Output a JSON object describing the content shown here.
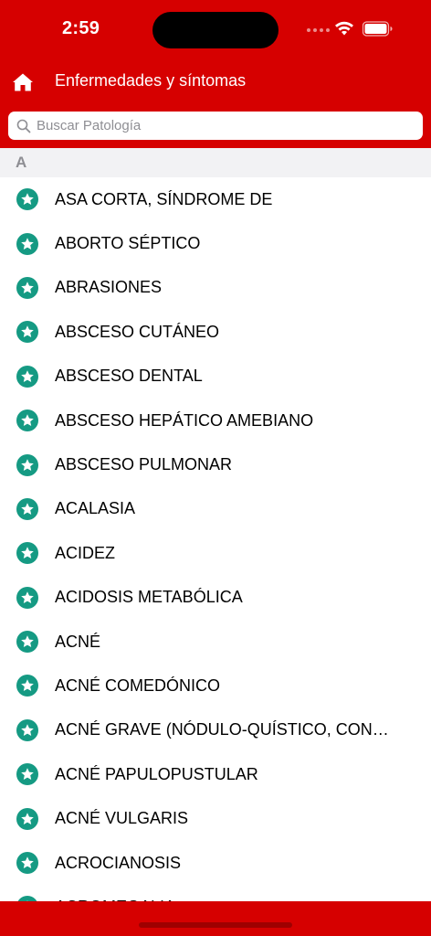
{
  "status": {
    "time": "2:59"
  },
  "nav": {
    "title": "Enfermedades y síntomas",
    "home_icon": "home-icon"
  },
  "search": {
    "placeholder": "Buscar Patología",
    "value": ""
  },
  "section": {
    "letter": "A"
  },
  "items": [
    {
      "label": "ASA CORTA, SÍNDROME DE"
    },
    {
      "label": "ABORTO SÉPTICO"
    },
    {
      "label": "ABRASIONES"
    },
    {
      "label": "ABSCESO CUTÁNEO"
    },
    {
      "label": "ABSCESO DENTAL"
    },
    {
      "label": "ABSCESO HEPÁTICO AMEBIANO"
    },
    {
      "label": "ABSCESO PULMONAR"
    },
    {
      "label": "ACALASIA"
    },
    {
      "label": "ACIDEZ"
    },
    {
      "label": "ACIDOSIS METABÓLICA"
    },
    {
      "label": "ACNÉ"
    },
    {
      "label": "ACNÉ COMEDÓNICO"
    },
    {
      "label": "ACNÉ GRAVE (NÓDULO-QUÍSTICO, CONG..."
    },
    {
      "label": "ACNÉ PAPULOPUSTULAR"
    },
    {
      "label": "ACNÉ VULGARIS"
    },
    {
      "label": "ACROCIANOSIS"
    },
    {
      "label": "ACROMEGALIA"
    }
  ],
  "colors": {
    "brand_red": "#d60000",
    "star_badge": "#159a83",
    "section_bg": "#f2f2f4"
  }
}
